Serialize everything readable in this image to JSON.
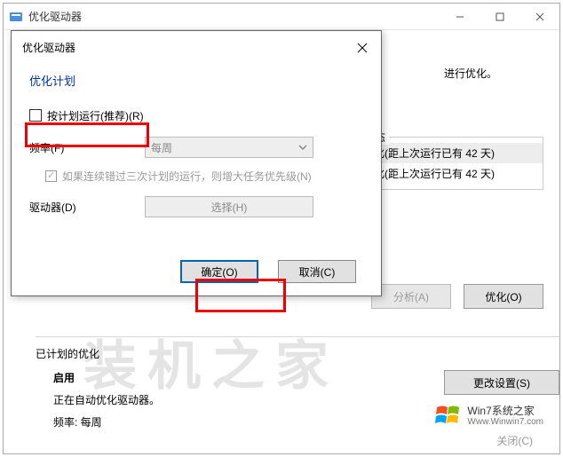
{
  "main": {
    "title": "优化驱动器",
    "info_line": "进行优化。",
    "status": {
      "group_title": "态",
      "rows": [
        "化(距上次运行已有 42 天)",
        "化(距上次运行已有 42 天)"
      ]
    },
    "buttons": {
      "analyze": "分析(A)",
      "optimize": "优化(O)"
    },
    "sched": {
      "title": "已计划的优化",
      "enabled": "启用",
      "desc": "正在自动优化驱动器。",
      "freq_line": "频率: 每周",
      "change": "更改设置(S)"
    },
    "footer_close": "关闭(C)"
  },
  "dialog": {
    "title": "优化驱动器",
    "heading": "优化计划",
    "run_on_schedule": "按计划运行(推荐)(R)",
    "freq_label": "频率(F)",
    "freq_value": "每周",
    "boost": "如果连续错过三次计划的运行，则增大任务优先级(N)",
    "drives_label": "驱动器(D)",
    "choose": "选择(H)",
    "ok": "确定(O)",
    "cancel": "取消(C)"
  },
  "watermark": "装机之家",
  "logo": {
    "line1": "Win7系统之家",
    "line2": "Www.Winwin7.com"
  }
}
